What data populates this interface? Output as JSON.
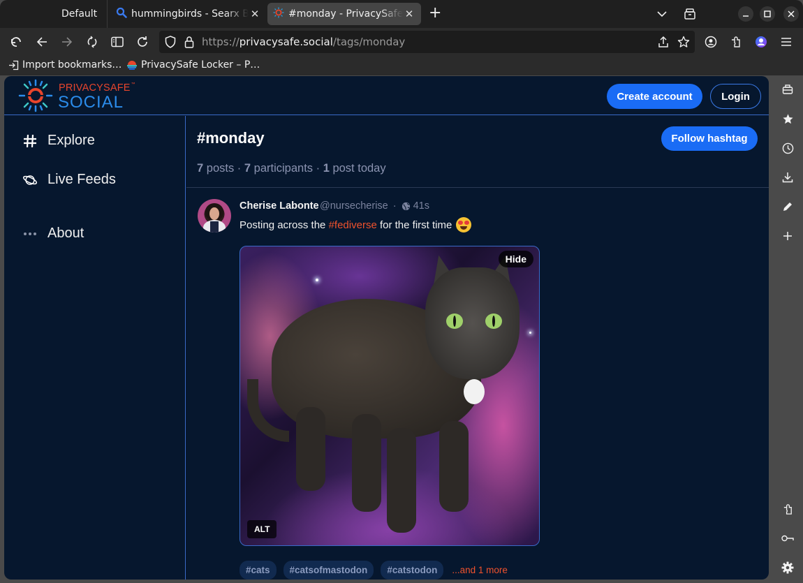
{
  "browser": {
    "tabs": [
      {
        "label": "Default",
        "icon": "none"
      },
      {
        "label": "hummingbirds - Searx Be",
        "icon": "search-icon"
      },
      {
        "label": "#monday - PrivacySafe Sc",
        "icon": "privacysafe-icon",
        "active": true
      }
    ],
    "url": {
      "scheme": "https://",
      "host": "privacysafe.social",
      "path": "/tags/monday"
    },
    "bookmarks": [
      {
        "label": "Import bookmarks…",
        "icon": "import-icon"
      },
      {
        "label": "PrivacySafe Locker – P…",
        "icon": "locker-icon"
      }
    ]
  },
  "site": {
    "logo_top": "PRIVACYSAFE",
    "logo_tm": "™",
    "logo_bottom": "SOCIAL",
    "create_account": "Create account",
    "login": "Login",
    "accent": "#1a6cf5",
    "tag_color": "#f0522d"
  },
  "sidebar": {
    "items": [
      {
        "label": "Explore",
        "icon": "hashtag-icon"
      },
      {
        "label": "Live Feeds",
        "icon": "planet-icon"
      },
      {
        "label": "About",
        "icon": "ellipsis-icon"
      }
    ]
  },
  "hashtag": {
    "title": "#monday",
    "follow": "Follow hashtag",
    "posts_count": "7",
    "posts_label": " posts · ",
    "participants_count": "7",
    "participants_label": " participants · ",
    "today_count": "1",
    "today_label": " post today"
  },
  "post": {
    "author": "Cherise Labonte",
    "handle": "@nursecherise",
    "separator": "·",
    "visibility": "globe-icon",
    "time": "41s",
    "text_before": "Posting across the ",
    "text_tag": "#fediverse",
    "text_after": " for the first time",
    "emoji": "smiling-face-with-heart-eyes",
    "media": {
      "hide_label": "Hide",
      "alt_label": "ALT",
      "description": "grey cat on galaxy background"
    },
    "tags": [
      "#cats",
      "#catsofmastodon",
      "#catstodon"
    ],
    "more_tags": "...and 1 more"
  }
}
